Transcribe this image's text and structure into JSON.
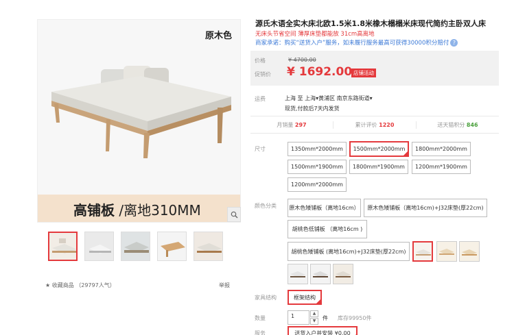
{
  "gallery": {
    "color_tag": "原木色",
    "banner_bold": "高铺板",
    "banner_rest": " /离地310MM",
    "favorite": "★ 收藏商品 （29797人气）",
    "report": "举报"
  },
  "product": {
    "title": "源氏木语全实木床北欧1.5米1.8米橡木榻榻米床现代简约主卧双人床",
    "subtitle1": "无床头节省空间 薄厚床垫都能放 31cm高离地",
    "subtitle2": "商家承诺：购买“送货入户”服务，如未履行服务最高可获得30000积分赔付",
    "promise_icon": "?"
  },
  "price": {
    "label": "价格",
    "old": "¥ 4700.00",
    "promo_label": "促销价",
    "promo": "¥ 1692.00",
    "badge": "店铺活动"
  },
  "shipping": {
    "label": "运费",
    "route": "上海  至 上海▾黄浦区 南京东路街道▾",
    "note": "现货,付款后7天内发货"
  },
  "stats": {
    "monthly_label": "月销量",
    "monthly": "297",
    "reviews_label": "累计评价",
    "reviews": "1220",
    "points_label": "送天猫积分",
    "points": "846"
  },
  "size": {
    "label": "尺寸",
    "options": [
      "1350mm*2000mm",
      "1500mm*2000mm",
      "1800mm*2000mm",
      "1500mm*1900mm",
      "1800mm*1900mm",
      "1200mm*1900mm",
      "1200mm*2000mm"
    ]
  },
  "color": {
    "label": "颜色分类",
    "options": [
      "原木色矮铺板（离地16cm）",
      "原木色矮铺板（离地16cm)+J32床垫(厚22cm)",
      "胡桃色低铺板 （离地16cm )",
      "胡桃色矮铺板 (离地16cm)+J32床垫(厚22cm)"
    ]
  },
  "structure": {
    "label": "家具结构",
    "option": "框架结构"
  },
  "quantity": {
    "label": "数量",
    "value": "1",
    "unit": "件",
    "stock": "库存99950件",
    "up": "▲",
    "down": "▼"
  },
  "service": {
    "label": "服务",
    "option": "送货入户并安装 ¥0.00"
  },
  "icons": {
    "zoom": "magnifier-icon"
  },
  "colors": {
    "accent": "#e4393c",
    "link": "#3c7ad7",
    "green": "#4ba03d",
    "banner": "#f4e1cc"
  }
}
